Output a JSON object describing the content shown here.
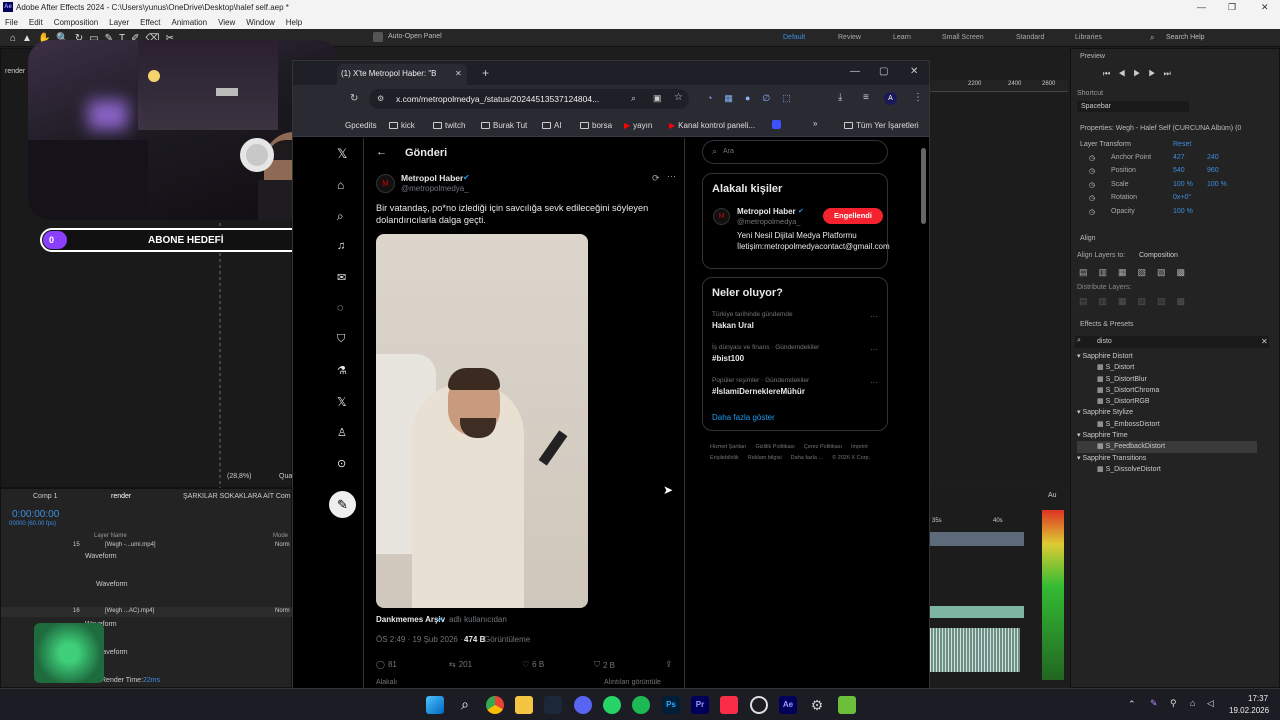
{
  "ae": {
    "title": "Adobe After Effects 2024 - C:\\Users\\yunus\\OneDrive\\Desktop\\halef self.aep *",
    "menu": [
      "File",
      "Edit",
      "Composition",
      "Layer",
      "Effect",
      "Animation",
      "View",
      "Window",
      "Help"
    ],
    "auto_open_panel": "Auto-Open Panel",
    "layer_none": "Layer: (none)",
    "workspaces": [
      "Default",
      "Review",
      "Learn",
      "Small Screen",
      "Standard",
      "Libraries"
    ],
    "search_help": "Search Help",
    "render_tab": "render",
    "zoom": "(28,8%)",
    "quality": "Qua",
    "ruler": [
      "2200",
      "2400",
      "2600"
    ],
    "preview": {
      "title": "Preview",
      "shortcut_label": "Shortcut",
      "shortcut_value": "Spacebar"
    },
    "properties": {
      "title": "Properties: Wegh - Halef Self (CURCUNA Albüm) (0",
      "section": "Layer Transform",
      "reset": "Reset",
      "rows": [
        {
          "label": "Anchor Point",
          "v1": "427",
          "v2": "240"
        },
        {
          "label": "Position",
          "v1": "540",
          "v2": "960"
        },
        {
          "label": "Scale",
          "v1": "100 %",
          "v2": "100 %"
        },
        {
          "label": "Rotation",
          "v1": "0x+0°",
          "v2": ""
        },
        {
          "label": "Opacity",
          "v1": "100 %",
          "v2": ""
        }
      ]
    },
    "align": {
      "title": "Align",
      "align_to_label": "Align Layers to:",
      "align_to_value": "Composition",
      "distribute": "Distribute Layers:"
    },
    "effects": {
      "title": "Effects & Presets",
      "search": "disto",
      "groups": [
        {
          "name": "Sapphire Distort",
          "items": [
            "S_Distort",
            "S_DistortBlur",
            "S_DistortChroma",
            "S_DistortRGB"
          ]
        },
        {
          "name": "Sapphire Stylize",
          "items": [
            "S_EmbossDistort"
          ]
        },
        {
          "name": "Sapphire Time",
          "items": [
            "S_FeedbackDistort"
          ]
        },
        {
          "name": "Sapphire Transitions",
          "items": [
            "S_DissolveDistort"
          ]
        }
      ]
    },
    "timeline": {
      "tabs": [
        "Comp 1",
        "render",
        "ŞARKILAR SOKAKLARA AİT Com"
      ],
      "timecode": "0:00:00:00",
      "fps": "00000 (60.00 fps)",
      "col_layer": "Layer Name",
      "col_mode": "Mode",
      "layers": [
        {
          "num": "15",
          "name": "[Wegh -...umi.mp4]",
          "mode": "Norm"
        },
        {
          "num": "16",
          "name": "[Wegh ...AC).mp4]",
          "mode": "Norm"
        }
      ],
      "waveform": "Waveform",
      "render_time": "Render Time:",
      "render_time_value": "22ms",
      "time_35": "35s",
      "time_40": "40s",
      "audio_label": "Au"
    }
  },
  "overlay": {
    "goal_label": "ABONE HEDEFİ",
    "goal_current": "0",
    "goal_target": "5"
  },
  "browser": {
    "tab_title": "(1) X'te Metropol Haber: \"B",
    "url": "x.com/metropolmedya_/status/20244513537124804...",
    "bookmarks": [
      "Gpcedits",
      "kick",
      "twitch",
      "Burak Tut",
      "AI",
      "borsa",
      "yayın",
      "Kanal kontrol paneli...",
      "Tüm Yer İşaretleri"
    ]
  },
  "x": {
    "header": "Gönderi",
    "author": "Metropol Haber",
    "handle": "@metropolmedya_",
    "text": "Bir vatandaş, po*no izlediği için savcılığa sevk edileceğini söyleyen dolandırıcılarla dalga geçti.",
    "credit_name": "Dankmemes Arşiv",
    "credit_suffix": "adlı kullanıcıdan",
    "meta_time": "ÖS 2:49 · 19 Şub 2026 ·",
    "meta_views": "474 B",
    "meta_views_label": "Görüntüleme",
    "stats": {
      "replies": "81",
      "reposts": "201",
      "likes": "6 B",
      "bookmarks": "2 B"
    },
    "footer_left": "Alakalı",
    "footer_right": "Alıntıları görüntüle",
    "search_placeholder": "Ara",
    "related": {
      "title": "Alakalı kişiler",
      "name": "Metropol Haber",
      "handle": "@metropolmedya_",
      "button": "Engellendi",
      "bio": "Yeni Nesil Dijital Medya Platformu İletişim:metropolmedyacontact@gmail.com"
    },
    "trending": {
      "title": "Neler oluyor?",
      "items": [
        {
          "context": "Türkiye tarihinde gündemde",
          "topic": "Hakan Ural"
        },
        {
          "context": "İş dünyası ve finans · Gündemdekiler",
          "topic": "#bist100"
        },
        {
          "context": "Popüler reşimler · Gündemdekiler",
          "topic": "#İslamiDerneklereMühür"
        }
      ],
      "more": "Daha fazla göster"
    },
    "footer_links": [
      "Hizmet Şartları",
      "Gizlilik Politikası",
      "Çerez Politikası",
      "Imprint",
      "Erişilebilirlik",
      "Reklam bilgisi",
      "Daha fazla ...",
      "© 2026 X Corp."
    ]
  },
  "taskbar": {
    "time": "17:37",
    "date": "19.02.2026"
  },
  "colors": {
    "ae_blue": "#3d8ee0",
    "x_red": "#f4212e",
    "x_blue": "#1d9bf0",
    "goal_purple": "#8a3ffc"
  }
}
